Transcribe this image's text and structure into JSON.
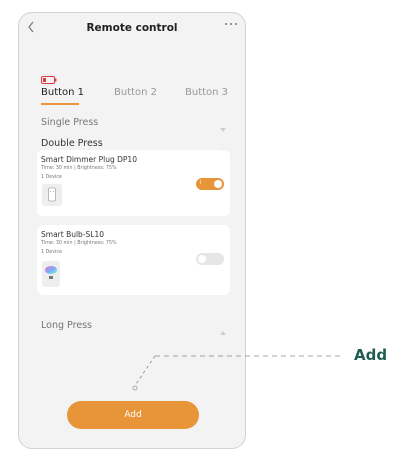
{
  "header": {
    "title": "Remote control",
    "back_icon": "chevron-left-icon",
    "more_icon": "more-dots-icon"
  },
  "battery": {
    "label": "5%",
    "icon": "battery-low-icon",
    "color": "#e0393e"
  },
  "tabs": [
    {
      "label": "Button 1",
      "active": true
    },
    {
      "label": "Button 2",
      "active": false
    },
    {
      "label": "Button 3",
      "active": false
    }
  ],
  "sections": {
    "single_press": "Single Press",
    "double_press": "Double Press",
    "long_press": "Long Press"
  },
  "devices": [
    {
      "name": "Smart Dimmer Plug DP10",
      "detail": "Time: 30 min  |  Brightness: 75%",
      "count": "1 Device",
      "toggle_on": true,
      "toggle_text": "I"
    },
    {
      "name": "Smart Bulb-SL10",
      "detail": "Time: 30 min  |  Brightness: 75%",
      "count": "1 Device",
      "toggle_on": false
    }
  ],
  "add_button": {
    "label": "Add"
  },
  "callout": {
    "label": "Add"
  },
  "colors": {
    "accent": "#e8953a",
    "callout": "#1f5c54"
  }
}
